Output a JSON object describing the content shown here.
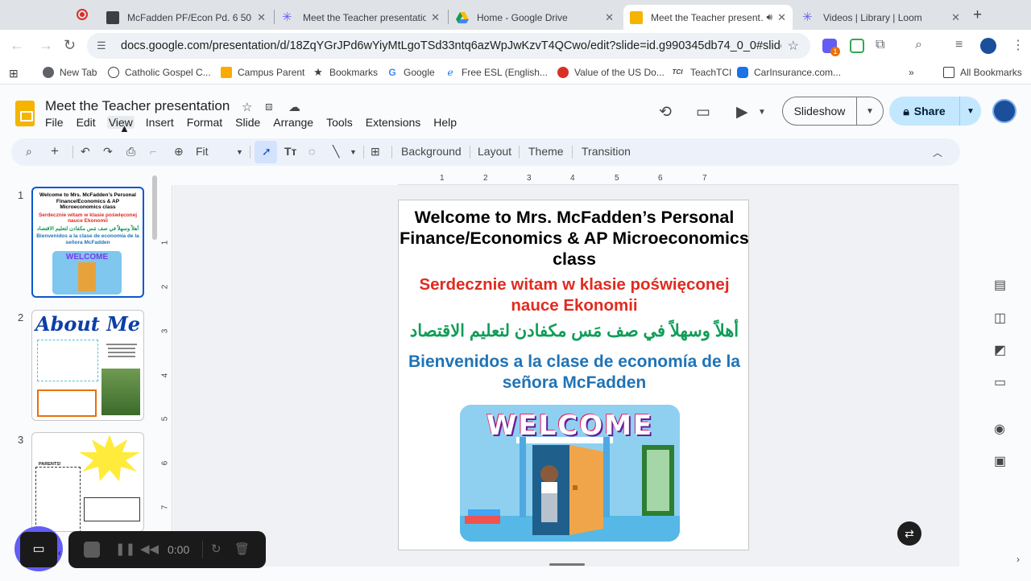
{
  "browser": {
    "tabs": [
      {
        "title": "McFadden PF/Econ Pd. 6 50…",
        "active": false
      },
      {
        "title": "Meet the Teacher presentatio…",
        "active": false
      },
      {
        "title": "Home - Google Drive",
        "active": false
      },
      {
        "title": "Meet the Teacher present…",
        "active": true
      },
      {
        "title": "Videos | Library | Loom",
        "active": false
      }
    ],
    "url": "docs.google.com/presentation/d/18ZqYGrJPd6wYiyMtLgoTSd33ntq6azWpJwKzvT4QCwo/edit?slide=id.g990345db74_0_0#slide=id.g...",
    "bookmarks": [
      "New Tab",
      "Catholic Gospel C...",
      "Campus Parent",
      "Bookmarks",
      "Google",
      "Free ESL (English...",
      "Value of the US Do...",
      "TeachTCI",
      "CarInsurance.com..."
    ],
    "all_bookmarks": "All Bookmarks",
    "ext_badge": "1"
  },
  "app": {
    "title": "Meet the Teacher presentation",
    "menu": [
      "File",
      "Edit",
      "View",
      "Insert",
      "Format",
      "Slide",
      "Arrange",
      "Tools",
      "Extensions",
      "Help"
    ],
    "slideshow_label": "Slideshow",
    "share_label": "Share",
    "toolbar": {
      "zoom": "Fit",
      "background": "Background",
      "layout": "Layout",
      "theme": "Theme",
      "transition": "Transition"
    }
  },
  "filmstrip": {
    "numbers": [
      "1",
      "2",
      "3"
    ],
    "slide2_title": "About Me",
    "slide3_parents": "PARENTS!"
  },
  "ruler": {
    "top": [
      "1",
      "2",
      "3",
      "4",
      "5",
      "6",
      "7"
    ],
    "left": [
      "1",
      "2",
      "3",
      "4",
      "5",
      "6",
      "7"
    ]
  },
  "slide": {
    "title": "Welcome to Mrs. McFadden’s Personal Finance/Economics & AP Microeconomics class",
    "polish": "Serdecznie witam w klasie poświęconej nauce Ekonomii",
    "arabic": "أهلاً وسهلاً في صف مَس مكفادن لتعليم الاقتصاد",
    "spanish": "Bienvenidos a la clase de economía de la señora McFadden",
    "image_text": "WELCOME"
  },
  "loom": {
    "time": "0:00"
  },
  "colors": {
    "accent": "#0b57d0",
    "share_bg": "#c2e7ff",
    "slide_red": "#e02b20",
    "slide_green": "#0f9d58",
    "slide_blue": "#1f73b7",
    "loom_purple": "#625df5"
  }
}
